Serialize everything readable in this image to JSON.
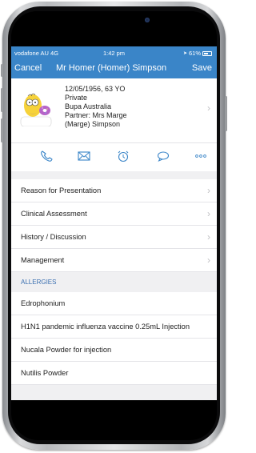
{
  "status_bar": {
    "carrier": "vodafone AU  4G",
    "time": "1:42 pm",
    "battery": "61%"
  },
  "navbar": {
    "cancel_label": "Cancel",
    "title": "Mr Homer (Homer) Simpson",
    "save_label": "Save"
  },
  "patient": {
    "lines": [
      "12/05/1956, 63 YO",
      "Private",
      "Bupa Australia",
      "Partner: Mrs Marge",
      "(Marge) Simpson"
    ]
  },
  "actions": [
    {
      "icon": "phone-icon"
    },
    {
      "icon": "mail-icon"
    },
    {
      "icon": "alarm-icon"
    },
    {
      "icon": "message-icon"
    },
    {
      "icon": "more-icon"
    }
  ],
  "sections": [
    {
      "label": "Reason for Presentation"
    },
    {
      "label": "Clinical Assessment"
    },
    {
      "label": "History / Discussion"
    },
    {
      "label": "Management"
    }
  ],
  "allergies": {
    "header": "ALLERGIES",
    "items": [
      "Edrophonium",
      "H1N1 pandemic influenza vaccine 0.25mL Injection",
      "Nucala Powder for injection",
      "Nutilis Powder"
    ]
  },
  "colors": {
    "accent": "#3a85c8",
    "header_text": "#3a6fb0",
    "background": "#f0f0f2"
  }
}
